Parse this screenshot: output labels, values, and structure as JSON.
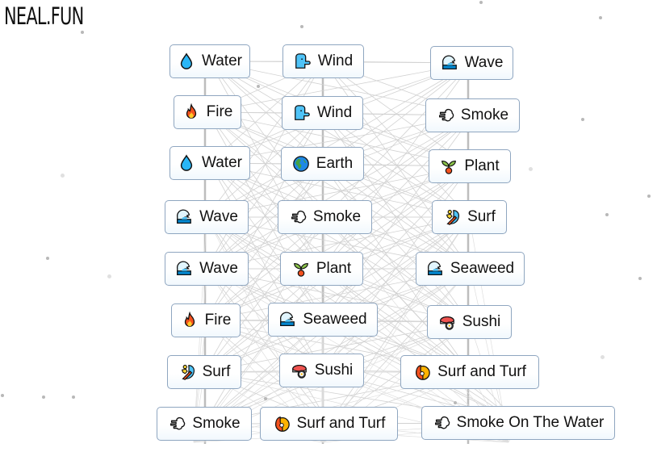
{
  "app": {
    "logo": "NEAL.FUN"
  },
  "board": {
    "columns": [
      {
        "items": [
          {
            "label": "Water",
            "icon": "water-drop-icon"
          },
          {
            "label": "Fire",
            "icon": "fire-icon"
          },
          {
            "label": "Water",
            "icon": "water-drop-icon"
          },
          {
            "label": "Wave",
            "icon": "wave-icon"
          },
          {
            "label": "Wave",
            "icon": "wave-icon"
          },
          {
            "label": "Fire",
            "icon": "fire-icon"
          },
          {
            "label": "Surf",
            "icon": "surfer-icon"
          },
          {
            "label": "Smoke",
            "icon": "smoke-puff-icon"
          }
        ]
      },
      {
        "items": [
          {
            "label": "Wind",
            "icon": "wind-face-icon"
          },
          {
            "label": "Wind",
            "icon": "wind-face-icon"
          },
          {
            "label": "Earth",
            "icon": "globe-icon"
          },
          {
            "label": "Smoke",
            "icon": "smoke-puff-icon"
          },
          {
            "label": "Plant",
            "icon": "seedling-icon"
          },
          {
            "label": "Seaweed",
            "icon": "wave-icon"
          },
          {
            "label": "Sushi",
            "icon": "sushi-icon"
          },
          {
            "label": "Surf and Turf",
            "icon": "shrimp-icon"
          }
        ]
      },
      {
        "items": [
          {
            "label": "Wave",
            "icon": "wave-icon"
          },
          {
            "label": "Smoke",
            "icon": "smoke-puff-icon"
          },
          {
            "label": "Plant",
            "icon": "seedling-icon"
          },
          {
            "label": "Surf",
            "icon": "surfer-icon"
          },
          {
            "label": "Seaweed",
            "icon": "wave-icon"
          },
          {
            "label": "Sushi",
            "icon": "sushi-icon"
          },
          {
            "label": "Surf and Turf",
            "icon": "shrimp-icon"
          },
          {
            "label": "Smoke On The Water",
            "icon": "smoke-puff-icon"
          }
        ]
      }
    ]
  },
  "colors": {
    "card_border": "#8fa6c0",
    "line": "#c8c8c8",
    "text": "#111111"
  }
}
